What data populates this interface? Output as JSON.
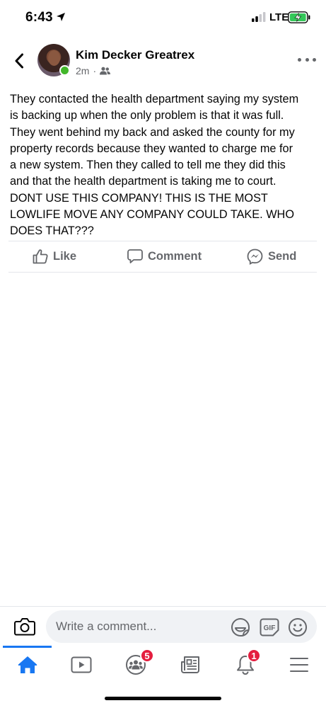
{
  "status_bar": {
    "time": "6:43",
    "network": "LTE",
    "icons": [
      "location-arrow-icon",
      "signal-icon",
      "battery-charging-icon"
    ]
  },
  "post": {
    "author": "Kim Decker Greatrex",
    "timestamp": "2m",
    "separator": "·",
    "audience_icon": "friends-icon",
    "online": true,
    "text": "They contacted the health department saying my system\nis backing up when the only problem is that it was full.\nThey went behind my back and asked the county for my\nproperty records because they wanted to charge me for\na new system.  Then they called to tell me they did this\nand that the health department is taking me to court.\nDONT USE THIS COMPANY! THIS IS THE MOST\nLOWLIFE MOVE ANY COMPANY COULD TAKE.  WHO\nDOES THAT???"
  },
  "actions": {
    "like": "Like",
    "comment": "Comment",
    "send": "Send"
  },
  "composer": {
    "placeholder": "Write a comment...",
    "gif_label": "GIF"
  },
  "tab_bar": {
    "active": "home",
    "groups_badge": "5",
    "notifications_badge": "1"
  },
  "colors": {
    "accent": "#1877f2",
    "secondary_text": "#65676b",
    "badge": "#e41e3f",
    "online": "#42b72a",
    "battery": "#34c759"
  }
}
